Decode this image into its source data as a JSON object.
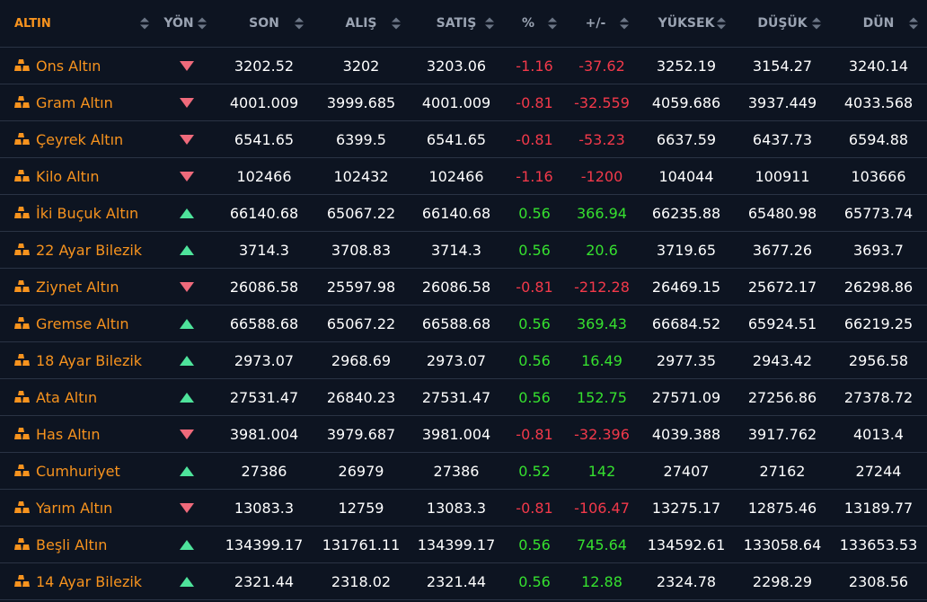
{
  "colors": {
    "background": "#0d1421",
    "accent": "#f7931e",
    "negative": "#f2394a",
    "positive": "#36e02f",
    "arrow_down": "#ef6a7b",
    "arrow_up": "#4ee39b",
    "header_text": "#9aa3b2"
  },
  "icons": {
    "row_icon": "gold-bars-icon",
    "up": "triangle-up-icon",
    "down": "triangle-down-icon",
    "sort": "sort-arrows-icon"
  },
  "headers": [
    "ALTIN",
    "YÖN",
    "SON",
    "ALIŞ",
    "SATIŞ",
    "%",
    "+/-",
    "YÜKSEK",
    "DÜŞÜK",
    "DÜN"
  ],
  "rows": [
    {
      "name": "Ons Altın",
      "dir": "down",
      "son": "3202.52",
      "alis": "3202",
      "satis": "3203.06",
      "pct": "-1.16",
      "chg": "-37.62",
      "high": "3252.19",
      "low": "3154.27",
      "prev": "3240.14"
    },
    {
      "name": "Gram Altın",
      "dir": "down",
      "son": "4001.009",
      "alis": "3999.685",
      "satis": "4001.009",
      "pct": "-0.81",
      "chg": "-32.559",
      "high": "4059.686",
      "low": "3937.449",
      "prev": "4033.568"
    },
    {
      "name": "Çeyrek Altın",
      "dir": "down",
      "son": "6541.65",
      "alis": "6399.5",
      "satis": "6541.65",
      "pct": "-0.81",
      "chg": "-53.23",
      "high": "6637.59",
      "low": "6437.73",
      "prev": "6594.88"
    },
    {
      "name": "Kilo Altın",
      "dir": "down",
      "son": "102466",
      "alis": "102432",
      "satis": "102466",
      "pct": "-1.16",
      "chg": "-1200",
      "high": "104044",
      "low": "100911",
      "prev": "103666"
    },
    {
      "name": "İki Buçuk Altın",
      "dir": "up",
      "son": "66140.68",
      "alis": "65067.22",
      "satis": "66140.68",
      "pct": "0.56",
      "chg": "366.94",
      "high": "66235.88",
      "low": "65480.98",
      "prev": "65773.74"
    },
    {
      "name": "22 Ayar Bilezik",
      "dir": "up",
      "son": "3714.3",
      "alis": "3708.83",
      "satis": "3714.3",
      "pct": "0.56",
      "chg": "20.6",
      "high": "3719.65",
      "low": "3677.26",
      "prev": "3693.7"
    },
    {
      "name": "Ziynet Altın",
      "dir": "down",
      "son": "26086.58",
      "alis": "25597.98",
      "satis": "26086.58",
      "pct": "-0.81",
      "chg": "-212.28",
      "high": "26469.15",
      "low": "25672.17",
      "prev": "26298.86"
    },
    {
      "name": "Gremse Altın",
      "dir": "up",
      "son": "66588.68",
      "alis": "65067.22",
      "satis": "66588.68",
      "pct": "0.56",
      "chg": "369.43",
      "high": "66684.52",
      "low": "65924.51",
      "prev": "66219.25"
    },
    {
      "name": "18 Ayar Bilezik",
      "dir": "up",
      "son": "2973.07",
      "alis": "2968.69",
      "satis": "2973.07",
      "pct": "0.56",
      "chg": "16.49",
      "high": "2977.35",
      "low": "2943.42",
      "prev": "2956.58"
    },
    {
      "name": "Ata Altın",
      "dir": "up",
      "son": "27531.47",
      "alis": "26840.23",
      "satis": "27531.47",
      "pct": "0.56",
      "chg": "152.75",
      "high": "27571.09",
      "low": "27256.86",
      "prev": "27378.72"
    },
    {
      "name": "Has Altın",
      "dir": "down",
      "son": "3981.004",
      "alis": "3979.687",
      "satis": "3981.004",
      "pct": "-0.81",
      "chg": "-32.396",
      "high": "4039.388",
      "low": "3917.762",
      "prev": "4013.4"
    },
    {
      "name": "Cumhuriyet",
      "dir": "up",
      "son": "27386",
      "alis": "26979",
      "satis": "27386",
      "pct": "0.52",
      "chg": "142",
      "high": "27407",
      "low": "27162",
      "prev": "27244"
    },
    {
      "name": "Yarım Altın",
      "dir": "down",
      "son": "13083.3",
      "alis": "12759",
      "satis": "13083.3",
      "pct": "-0.81",
      "chg": "-106.47",
      "high": "13275.17",
      "low": "12875.46",
      "prev": "13189.77"
    },
    {
      "name": "Beşli Altın",
      "dir": "up",
      "son": "134399.17",
      "alis": "131761.11",
      "satis": "134399.17",
      "pct": "0.56",
      "chg": "745.64",
      "high": "134592.61",
      "low": "133058.64",
      "prev": "133653.53"
    },
    {
      "name": "14 Ayar Bilezik",
      "dir": "up",
      "son": "2321.44",
      "alis": "2318.02",
      "satis": "2321.44",
      "pct": "0.56",
      "chg": "12.88",
      "high": "2324.78",
      "low": "2298.29",
      "prev": "2308.56"
    }
  ]
}
